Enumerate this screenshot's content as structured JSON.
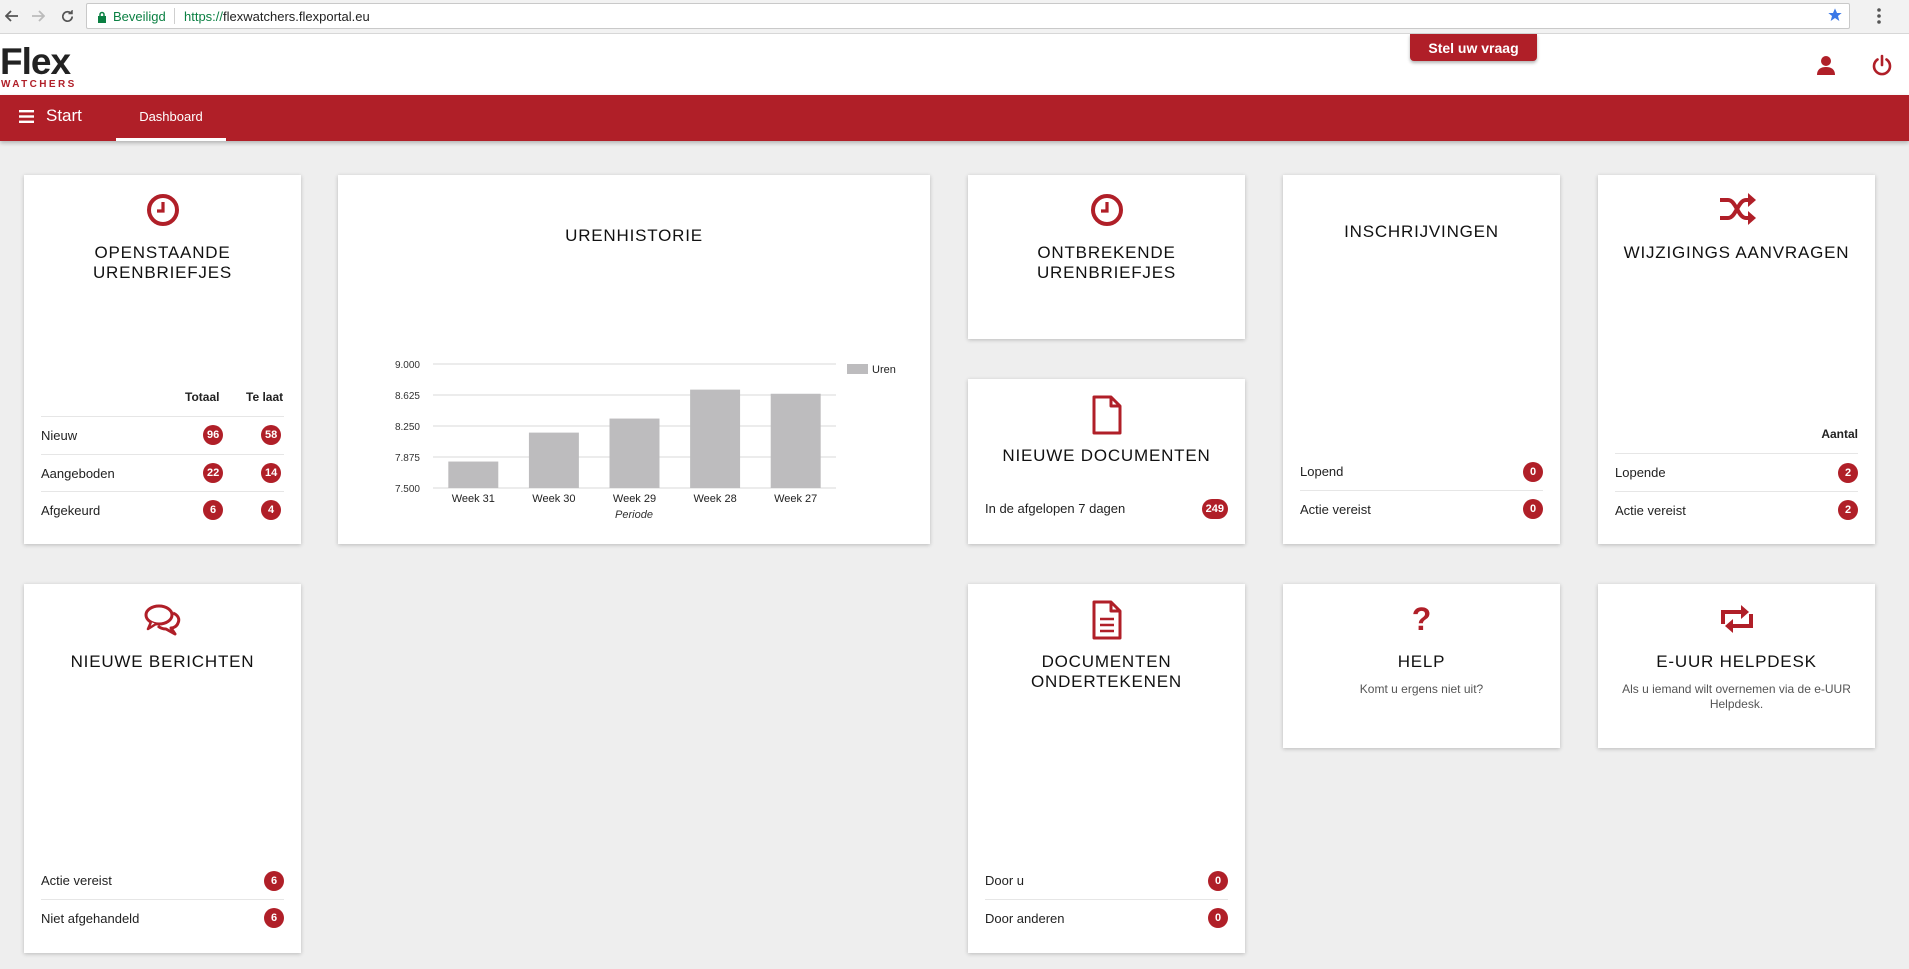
{
  "browser": {
    "secure_label": "Beveiligd",
    "url_scheme": "https://",
    "url_host": "flexwatchers.flexportal.eu"
  },
  "header": {
    "logo_main": "Flex",
    "logo_sub": "WATCHERS",
    "ask_button": "Stel uw vraag"
  },
  "navbar": {
    "start_label": "Start",
    "active_tab": "Dashboard"
  },
  "cards": {
    "openstaande": {
      "title": "OPENSTAANDE URENBRIEFJES",
      "col1": "Totaal",
      "col2": "Te laat",
      "rows": [
        {
          "label": "Nieuw",
          "totaal": "96",
          "te_laat": "58"
        },
        {
          "label": "Aangeboden",
          "totaal": "22",
          "te_laat": "14"
        },
        {
          "label": "Afgekeurd",
          "totaal": "6",
          "te_laat": "4"
        }
      ]
    },
    "urenhistorie": {
      "title": "URENHISTORIE"
    },
    "ontbrekende": {
      "title": "ONTBREKENDE URENBRIEFJES"
    },
    "nieuwe_documenten": {
      "title": "NIEUWE DOCUMENTEN",
      "rows": [
        {
          "label": "In de afgelopen 7 dagen",
          "value": "249"
        }
      ]
    },
    "inschrijvingen": {
      "title": "INSCHRIJVINGEN",
      "rows": [
        {
          "label": "Lopend",
          "value": "0"
        },
        {
          "label": "Actie vereist",
          "value": "0"
        }
      ]
    },
    "wijzigings": {
      "title": "WIJZIGINGS AANVRAGEN",
      "col": "Aantal",
      "rows": [
        {
          "label": "Lopende",
          "value": "2"
        },
        {
          "label": "Actie vereist",
          "value": "2"
        }
      ]
    },
    "berichten": {
      "title": "NIEUWE BERICHTEN",
      "rows": [
        {
          "label": "Actie vereist",
          "value": "6"
        },
        {
          "label": "Niet afgehandeld",
          "value": "6"
        }
      ]
    },
    "ondertekenen": {
      "title": "DOCUMENTEN ONDERTEKENEN",
      "rows": [
        {
          "label": "Door u",
          "value": "0"
        },
        {
          "label": "Door anderen",
          "value": "0"
        }
      ]
    },
    "help": {
      "title": "HELP",
      "sub": "Komt u ergens niet uit?"
    },
    "helpdesk": {
      "title": "E-UUR HELPDESK",
      "sub": "Als u iemand wilt overnemen via de e-UUR Helpdesk."
    }
  },
  "colors": {
    "brand": "#b01f28",
    "bar": "#bdbcbe"
  },
  "chart_data": {
    "type": "bar",
    "categories": [
      "Week 31",
      "Week 30",
      "Week 29",
      "Week 28",
      "Week 27"
    ],
    "series": [
      {
        "name": "Uren",
        "values": [
          7.82,
          8.17,
          8.34,
          8.69,
          8.64
        ]
      }
    ],
    "ylim": [
      7.5,
      9.0
    ],
    "yticks": [
      "7.500",
      "7.875",
      "8.250",
      "8.625",
      "9.000"
    ],
    "xlabel": "Periode",
    "ylabel": "",
    "legend": "top-right",
    "grid": true
  }
}
